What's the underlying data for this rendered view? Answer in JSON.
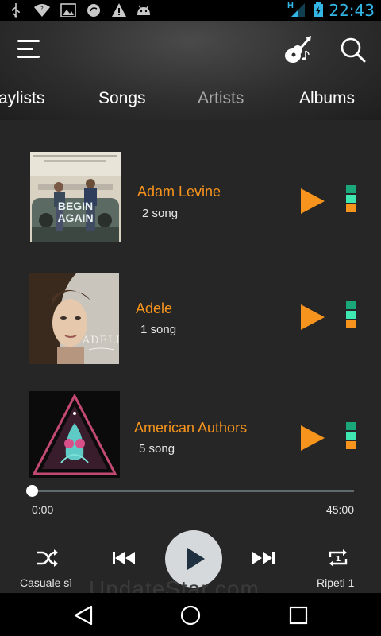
{
  "status_bar": {
    "time": "22:43",
    "network_label": "H",
    "icons": [
      "usb-icon",
      "wifi-icon",
      "image-icon",
      "sync-icon",
      "warning-icon",
      "android-icon",
      "signal-icon",
      "battery-charging-icon"
    ]
  },
  "header": {
    "menu_icon": "menu-icon",
    "guitar_icon": "guitar-music-icon",
    "search_icon": "search-icon"
  },
  "tabs": [
    {
      "label": "aylists"
    },
    {
      "label": "Songs"
    },
    {
      "label": "Artists",
      "active": true
    },
    {
      "label": "Albums"
    }
  ],
  "artists": [
    {
      "name": "Adam Levine",
      "count": "2 song",
      "cover": {
        "title_line1": "BEGIN",
        "title_line2": "AGAIN"
      }
    },
    {
      "name": "Adele",
      "count": "1 song",
      "cover": {
        "title": "ADELE"
      }
    },
    {
      "name": "American Authors",
      "count": "5 song",
      "cover": {}
    }
  ],
  "player": {
    "progress": 0,
    "current_time": "0:00",
    "total_time": "45:00",
    "shuffle_label": "Casuale sì",
    "repeat_label": "Ripeti 1",
    "repeat_badge": "1",
    "watermark": "UpdateStar.com"
  },
  "colors": {
    "accent_orange": "#f7941d",
    "eq_green": "#1aa87a",
    "eq_mint": "#3ee8b0",
    "clock_blue": "#33b5e5"
  }
}
